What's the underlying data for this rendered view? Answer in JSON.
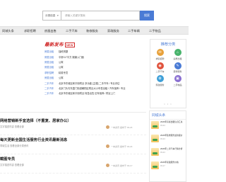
{
  "search": {
    "select_label": "分类信息",
    "placeholder": "请输入关键字搜索",
    "button_label": "搜索"
  },
  "nav": {
    "items": [
      "同城头条",
      "求职招聘",
      "房屋出售",
      "二手汽车",
      "装修服务",
      "家政服务",
      "二手车辆",
      "二手物品"
    ]
  },
  "latest": {
    "title": "最新发布",
    "badge": "NEW",
    "rows": [
      {
        "cat": "房屋出租",
        "txt": "独栋別墅"
      },
      {
        "cat": "房屋出租",
        "txt": "平房117平方 摊铺入门面"
      },
      {
        "cat": "房屋出租",
        "txt": "公寓"
      },
      {
        "cat": "房屋出租",
        "txt": "公寓"
      },
      {
        "cat": "求职招聘",
        "txt": "精英专员"
      },
      {
        "cat": "房屋出租",
        "txt": "公寓"
      },
      {
        "cat": "二手汽车",
        "txt": "北京市东城区和平街附近  多功能 [主楼] 二手汽车 / 专业评估"
      },
      {
        "cat": "二手汽车",
        "txt": "北京门头沟东直门街道朝阳区附近大小车型出租 / 汽车保养 / 专业"
      },
      {
        "cat": "二手汽车",
        "txt": "北京市东城区和平街附近 特急出售 旧车保养 / 附近上门"
      }
    ]
  },
  "recommend": {
    "title": "推荐分类",
    "items": [
      {
        "label": "求职招聘",
        "icon": "briefcase-icon",
        "color": "#e8a13a",
        "glyph": "✉"
      },
      {
        "label": "房屋出租",
        "icon": "house-icon",
        "color": "#48b36c",
        "glyph": "⌂"
      },
      {
        "label": "二手汽车",
        "icon": "car-icon",
        "color": "#e0533d",
        "glyph": "◉"
      },
      {
        "label": "装修服务",
        "icon": "tools-icon",
        "color": "#4a7bd5",
        "glyph": "✎"
      },
      {
        "label": "家政服务",
        "icon": "clean-icon",
        "color": "#3fa0d8",
        "glyph": "✿"
      },
      {
        "label": "二手物品",
        "icon": "box-icon",
        "color": "#8a6fd1",
        "glyph": "▣"
      }
    ],
    "dots": "• • •"
  },
  "news": [
    {
      "title": "网络营销新手宜选择（不重复、居家办公）",
      "sub": "文字描述内容 查看全部",
      "author": "一本资讯",
      "time": "发布于 03-24"
    },
    {
      "title": "每天更新全国生活服务行业资讯最新消息",
      "sub": "同城生活 查看全部分类资讯",
      "author": "一本资讯",
      "time": "发布于 03-24"
    },
    {
      "title": "截图专员",
      "sub": "文字描述内容 查看全部",
      "author": "一本资讯",
      "time": "发布于 03-17"
    }
  ],
  "city": {
    "title": "同城头条",
    "items": [
      {
        "text": "2020年房屋出租信息汇总",
        "date": "03-24"
      },
      {
        "text": "2020年装修服务最新报价",
        "date": "03-24"
      },
      {
        "text": "2020年二手汽车行情分析",
        "date": "03-24"
      },
      {
        "text": "2020年家政服务价格",
        "date": "03-17"
      }
    ]
  }
}
